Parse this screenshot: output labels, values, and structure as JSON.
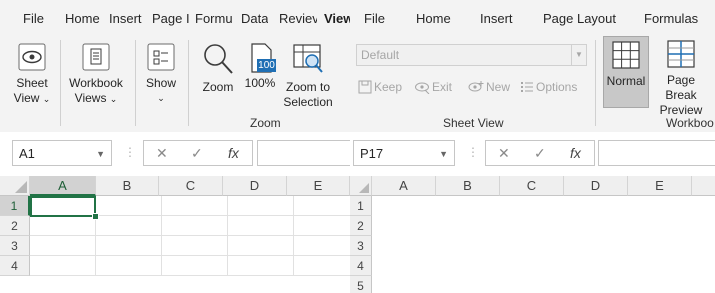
{
  "left": {
    "tabs": [
      "File",
      "Home",
      "Insert",
      "Page I",
      "Formu",
      "Data",
      "Reviev",
      "View"
    ],
    "ribbon": {
      "sheet_view": "Sheet View",
      "workbook_views": "Workbook Views",
      "show": "Show",
      "zoom": "Zoom",
      "zoom_100": "100%",
      "zoom_100_icon_text": "100",
      "zoom_to_selection": "Zoom to Selection",
      "group_zoom": "Zoom"
    },
    "name_box": "A1",
    "columns": [
      "A",
      "B",
      "C",
      "D",
      "E"
    ],
    "rows": [
      "1",
      "2",
      "3",
      "4"
    ]
  },
  "right": {
    "tabs": [
      "File",
      "Home",
      "Insert",
      "Page Layout",
      "Formulas"
    ],
    "ribbon": {
      "dropdown_value": "Default",
      "keep": "Keep",
      "exit": "Exit",
      "new": "New",
      "options": "Options",
      "group_sheet_view": "Sheet View",
      "normal": "Normal",
      "page_break_preview": "Page Break Preview",
      "group_workbook": "Workboo"
    },
    "name_box": "P17",
    "columns": [
      "A",
      "B",
      "C",
      "D",
      "E"
    ],
    "rows": [
      "1",
      "2",
      "3",
      "4",
      "5"
    ]
  },
  "colors": {
    "accent": "#217346",
    "ribbon_bg": "#f3f3f3",
    "disabled_text": "#a6a6a6"
  }
}
